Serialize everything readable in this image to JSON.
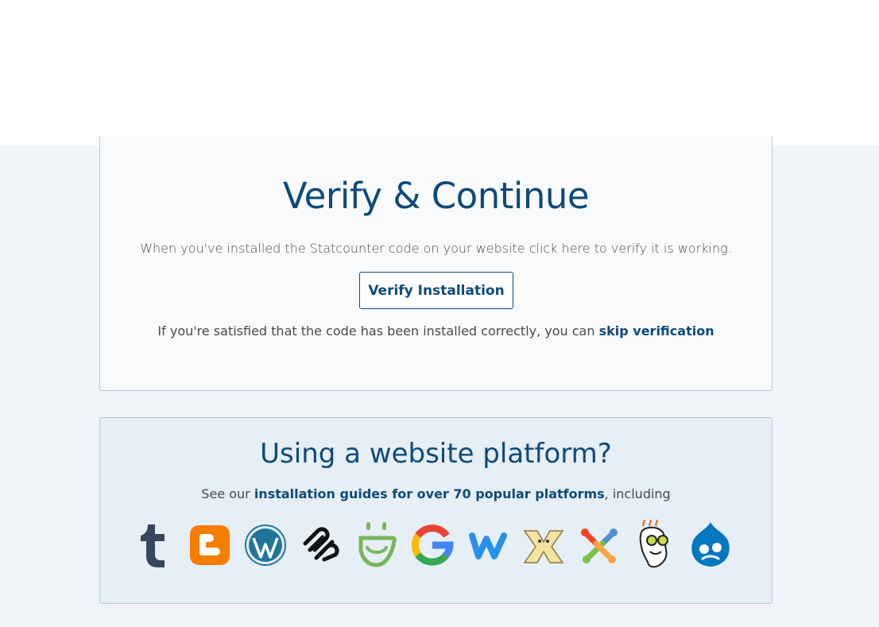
{
  "verify": {
    "title": "Verify & Continue",
    "description": "When you've installed the Statcounter code on your website click here to verify it is working.",
    "button_label": "Verify Installation",
    "skip_prefix": "If you're satisfied that the code has been installed correctly, you can ",
    "skip_link": "skip verification"
  },
  "platforms": {
    "title": "Using a website platform?",
    "desc_prefix": "See our ",
    "desc_link": "installation guides for over 70 popular platforms",
    "desc_suffix": ", including",
    "logos": [
      {
        "name": "tumblr-icon"
      },
      {
        "name": "blogger-icon"
      },
      {
        "name": "wordpress-icon"
      },
      {
        "name": "squarespace-icon"
      },
      {
        "name": "shopify-icon"
      },
      {
        "name": "google-icon"
      },
      {
        "name": "weebly-icon"
      },
      {
        "name": "wix-icon"
      },
      {
        "name": "joomla-icon"
      },
      {
        "name": "godaddy-icon"
      },
      {
        "name": "drupal-icon"
      }
    ]
  },
  "colors": {
    "accent": "#0e4a7a",
    "background": "#f1f5f9"
  }
}
